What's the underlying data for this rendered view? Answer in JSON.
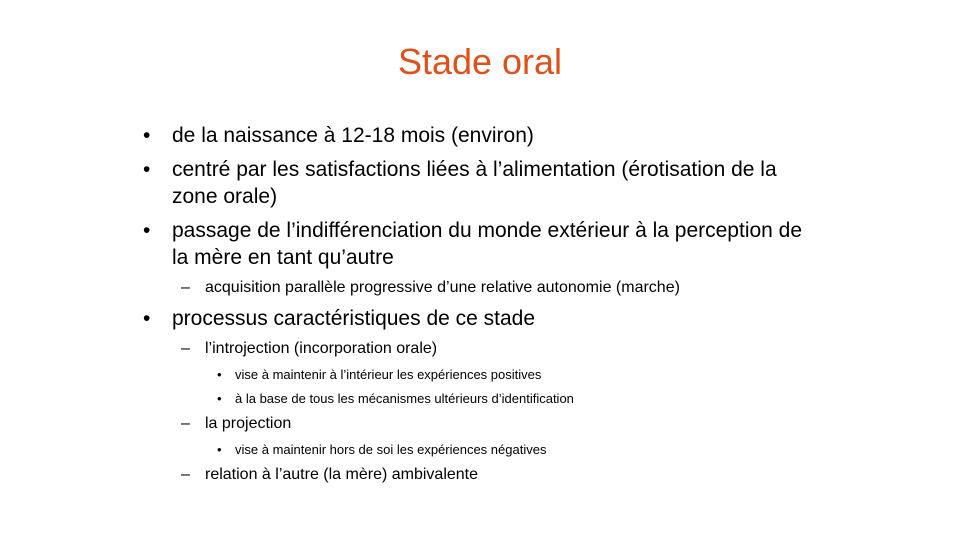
{
  "slide": {
    "title": "Stade oral",
    "title_color": "#e0501a",
    "bullet_symbol": "•",
    "dash_symbol": "–",
    "items": [
      {
        "text": "de la naissance à 12-18 mois (environ)"
      },
      {
        "text": "centré par les satisfactions liées à l’alimentation (érotisation de la zone orale)"
      },
      {
        "text": "passage de l’indifférenciation du monde extérieur à la perception de la mère en tant qu’autre"
      },
      {
        "text": "acquisition parallèle progressive d’une relative autonomie (marche)"
      },
      {
        "text": "processus caractéristiques de ce stade"
      },
      {
        "text": "l’introjection (incorporation orale)"
      },
      {
        "text": "vise à maintenir à l’intérieur les expériences positives"
      },
      {
        "text": "à la base de tous les mécanismes ultérieurs d’identification"
      },
      {
        "text": "la projection"
      },
      {
        "text": "vise à maintenir hors de soi les expériences négatives"
      },
      {
        "text": "relation à l’autre (la mère) ambivalente"
      }
    ]
  }
}
